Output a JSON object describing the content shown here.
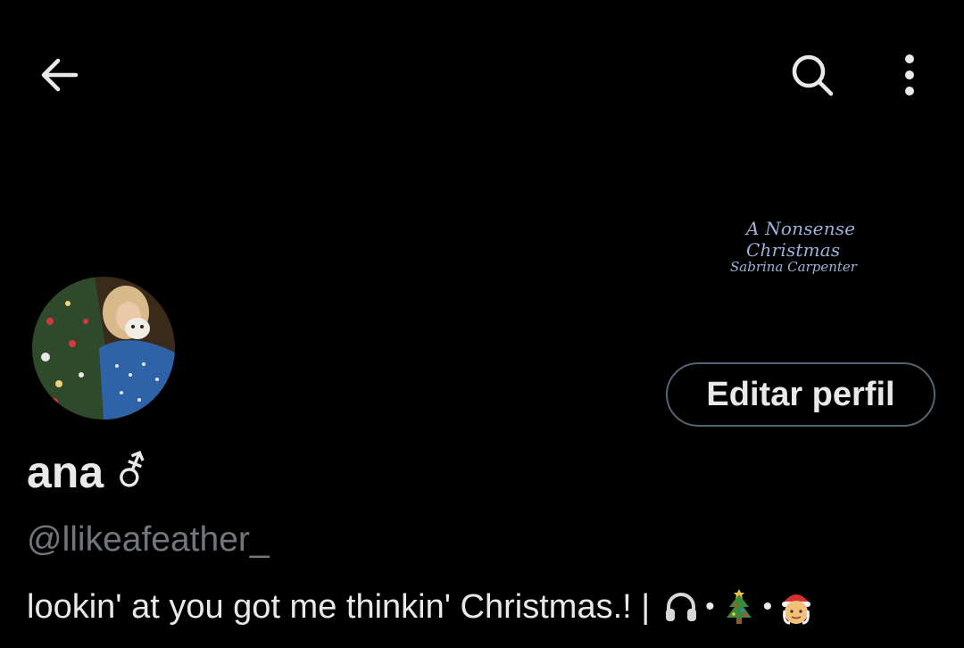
{
  "topbar": {
    "back_icon": "arrow-left-icon",
    "search_icon": "search-icon",
    "more_icon": "more-vertical-icon"
  },
  "banner": {
    "title": "A Nonsense Christmas",
    "subtitle": "Sabrina Carpenter"
  },
  "profile": {
    "display_name": "ana",
    "name_symbol": "⚦",
    "handle": "@llikeafeather_",
    "edit_button": "Editar perfil",
    "bio_text": "lookin' at you got me thinkin' Christmas.! |",
    "bio_separator": "•",
    "bio_emojis": [
      "headphones-icon",
      "christmas-tree-icon",
      "mrs-claus-icon"
    ]
  },
  "colors": {
    "background": "#000000",
    "text_primary": "#e7e9ea",
    "text_secondary": "#71767b",
    "button_border": "#536471",
    "banner_text": "#9db1d9"
  }
}
